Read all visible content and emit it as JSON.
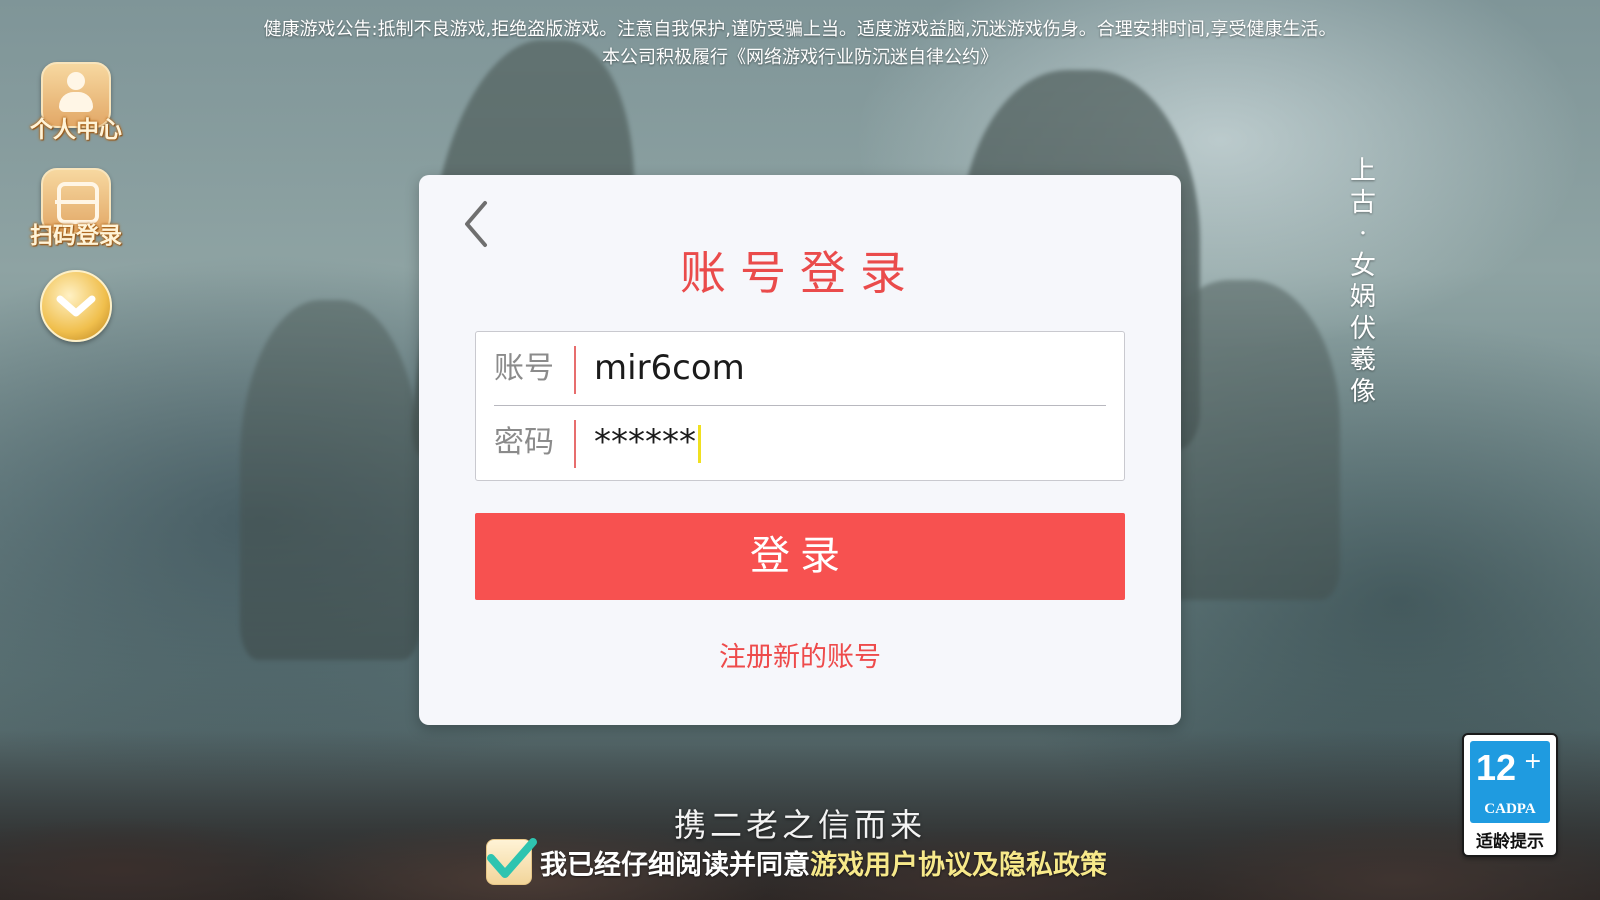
{
  "notice": {
    "line1": "健康游戏公告:抵制不良游戏,拒绝盗版游戏。注意自我保护,谨防受骗上当。适度游戏益脑,沉迷游戏伤身。合理安排时间,享受健康生活。",
    "line2": "本公司积极履行《网络游戏行业防沉迷自律公约》"
  },
  "sidebar": {
    "personal_center": "个人中心",
    "scan_login": "扫码登录"
  },
  "vertical_title": "上古·女娲伏羲像",
  "login_panel": {
    "title": "账号登录",
    "account_label": "账号",
    "account_value": "mir6com",
    "password_label": "密码",
    "password_value": "******",
    "login_button": "登录",
    "register_link": "注册新的账号"
  },
  "footer": {
    "slogan": "携二老之信而来",
    "agree_text": "我已经仔细阅读并同意",
    "agree_link": "游戏用户协议及隐私政策",
    "agree_checked": true
  },
  "age_rating": {
    "age": "12",
    "plus": "+",
    "org": "CADPA",
    "note": "适龄提示"
  },
  "colors": {
    "accent_red": "#f75150",
    "title_red": "#ea4b4b",
    "link_yellow": "#f7e98a",
    "rating_blue": "#1f9be0"
  }
}
